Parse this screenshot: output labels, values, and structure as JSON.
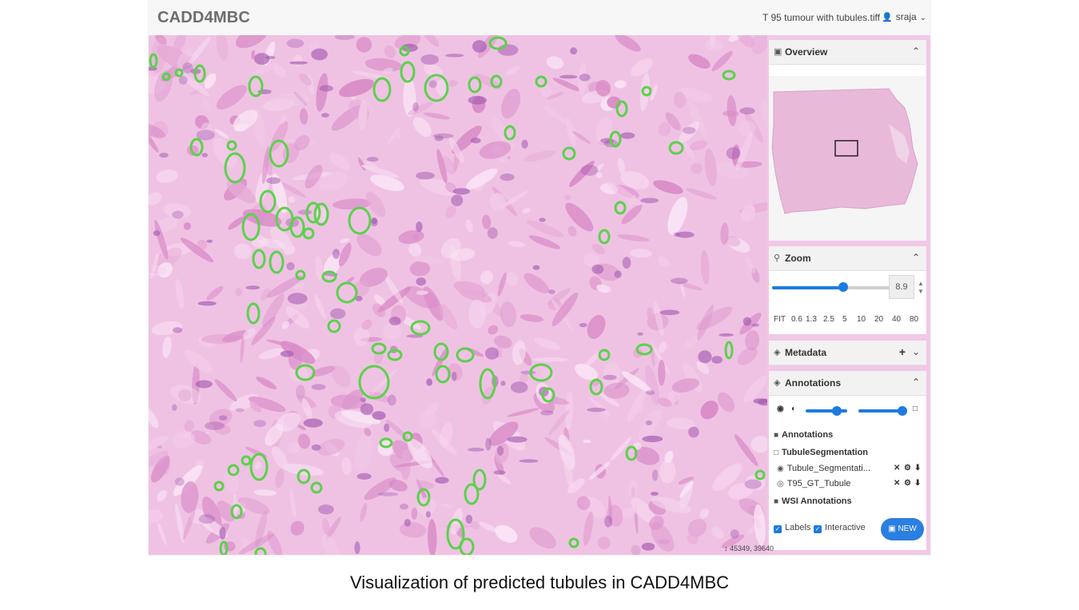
{
  "header": {
    "brand": "CADD4MBC",
    "filename": "T 95 tumour with tubules.tiff",
    "user": "sraja"
  },
  "overview": {
    "title": "Overview",
    "collapse_icon": "chevron-up-icon"
  },
  "zoom": {
    "title": "Zoom",
    "value": "8.9",
    "slider_fraction": 0.6,
    "levels": [
      "FIT",
      "0.6",
      "1.3",
      "2.5",
      "5",
      "10",
      "20",
      "40",
      "80"
    ]
  },
  "metadata": {
    "title": "Metadata"
  },
  "annotations": {
    "title": "Annotations",
    "opacity_fraction": 0.75,
    "stroke_fraction": 0.95,
    "tree": {
      "root": "Annotations",
      "group": "TubuleSegmentation",
      "items": [
        "Tubule_Segmentati...",
        "T95_GT_Tubule"
      ],
      "wsi": "WSI Annotations"
    },
    "labels_checkbox": "Labels",
    "interactive_checkbox": "Interactive",
    "new_button": "NEW"
  },
  "coordinates": "↕ 45349, 39640",
  "caption": "Visualization of predicted tubules in CADD4MBC",
  "colors": {
    "accent": "#1d7be0",
    "tissue": "#f1c8e6",
    "annotation": "#5bd24a"
  }
}
